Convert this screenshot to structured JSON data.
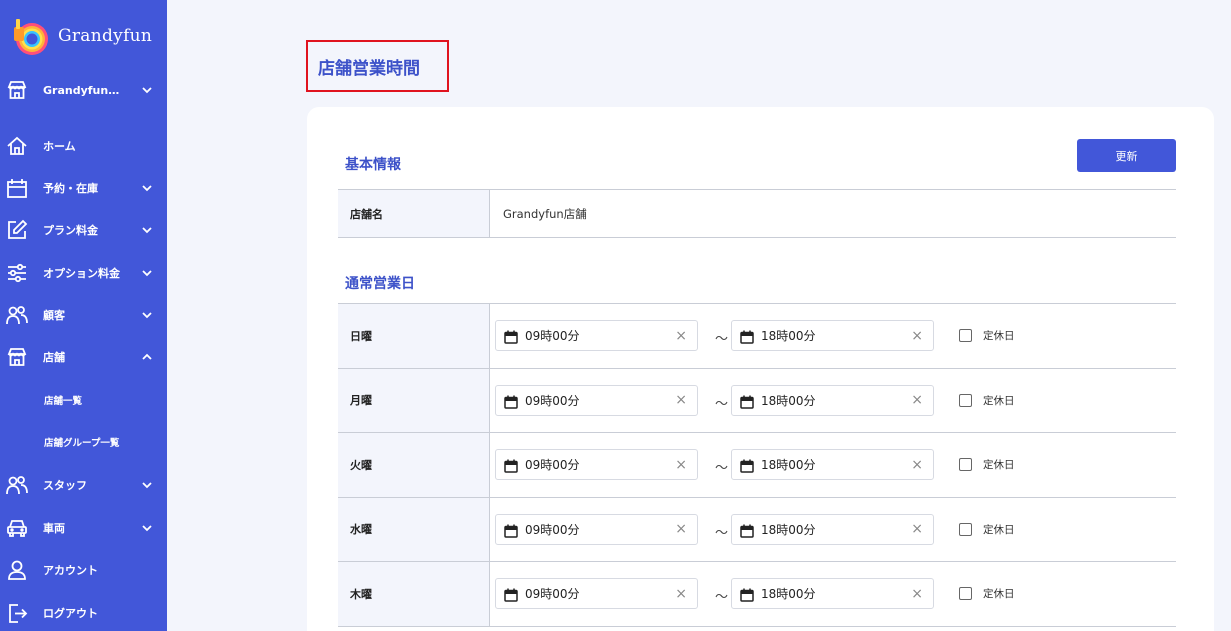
{
  "app": {
    "name": "Grandyfun"
  },
  "sidebar": {
    "store_selector": "Grandyfun…",
    "items": [
      {
        "label": "ホーム"
      },
      {
        "label": "予約・在庫"
      },
      {
        "label": "プラン料金"
      },
      {
        "label": "オプション料金"
      },
      {
        "label": "顧客"
      },
      {
        "label": "店舗"
      },
      {
        "label": "スタッフ"
      },
      {
        "label": "車両"
      },
      {
        "label": "アカウント"
      },
      {
        "label": "ログアウト"
      }
    ],
    "subitems": [
      {
        "label": "店舗一覧"
      },
      {
        "label": "店舗グループ一覧"
      }
    ]
  },
  "page": {
    "title": "店舗営業時間"
  },
  "basic_info": {
    "title": "基本情報",
    "update_label": "更新",
    "store_name_label": "店舗名",
    "store_name_value": "Grandyfun店舗"
  },
  "business_days": {
    "title": "通常営業日",
    "tilde": "〜",
    "holiday_label": "定休日",
    "rows": [
      {
        "day": "日曜",
        "start": "09時00分",
        "end": "18時00分",
        "holiday": false
      },
      {
        "day": "月曜",
        "start": "09時00分",
        "end": "18時00分",
        "holiday": false
      },
      {
        "day": "火曜",
        "start": "09時00分",
        "end": "18時00分",
        "holiday": false
      },
      {
        "day": "水曜",
        "start": "09時00分",
        "end": "18時00分",
        "holiday": false
      },
      {
        "day": "木曜",
        "start": "09時00分",
        "end": "18時00分",
        "holiday": false
      }
    ]
  },
  "colors": {
    "sidebar": "#4257d9",
    "accent": "#3d52c9",
    "highlight_border": "#e0131f",
    "background": "#f3f5fc"
  }
}
